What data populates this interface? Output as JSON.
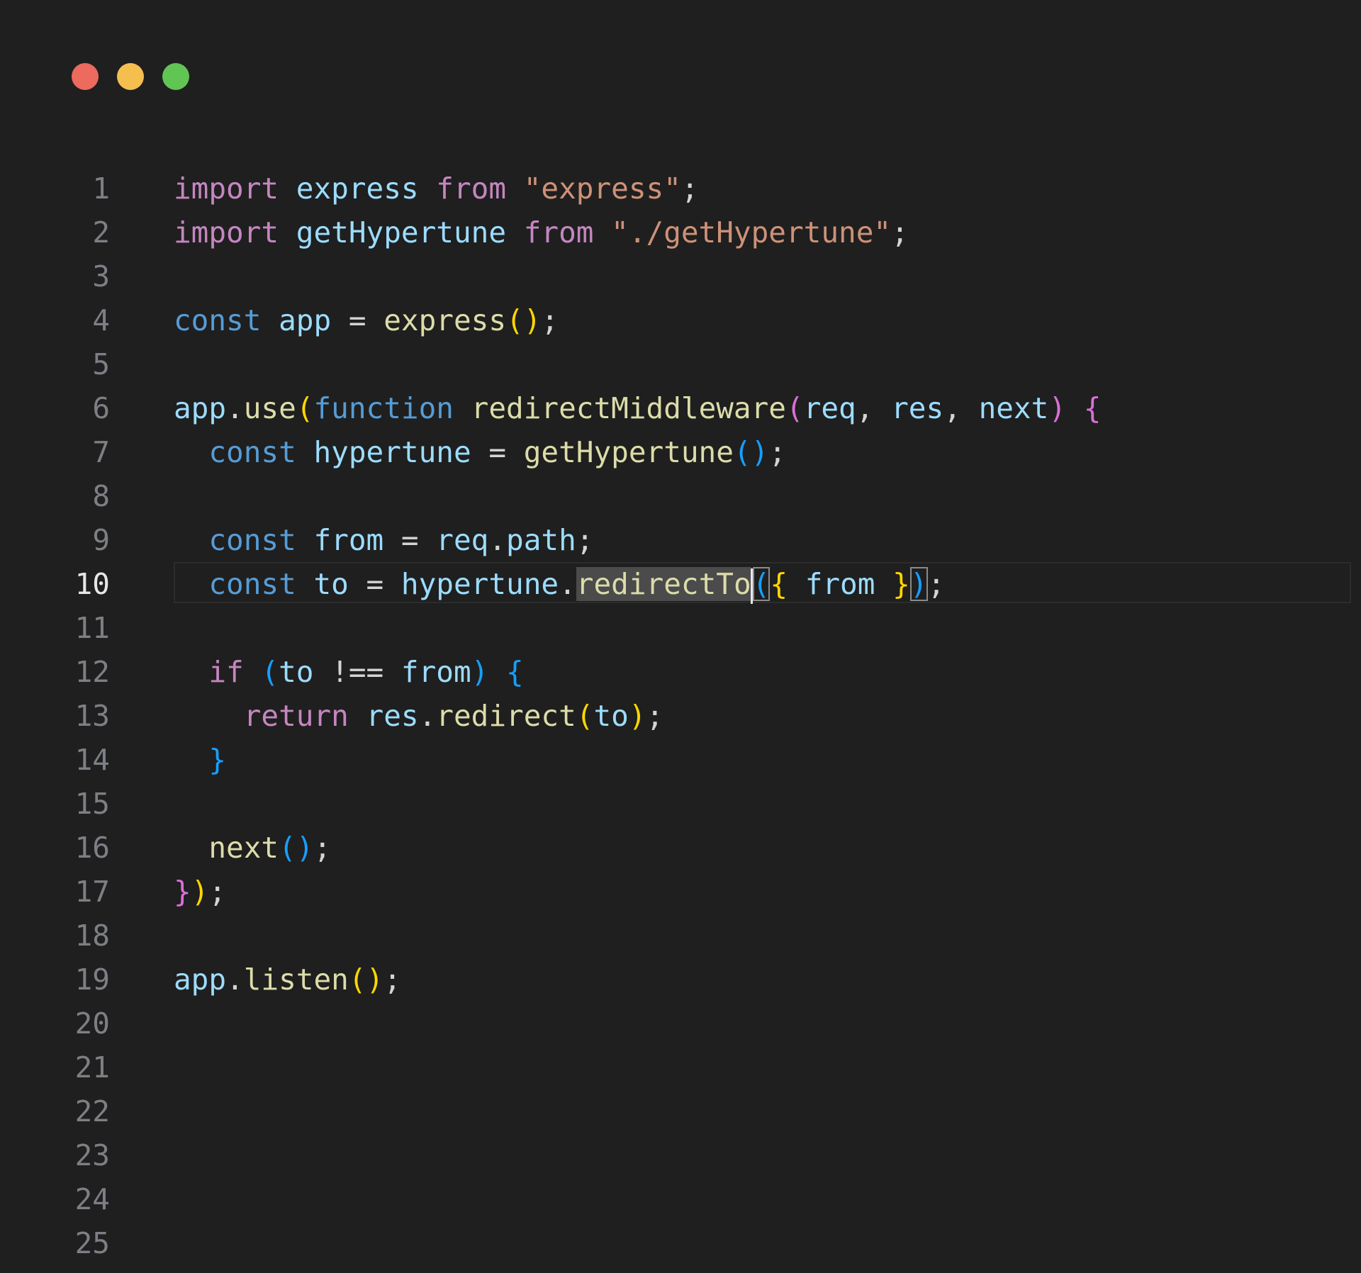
{
  "window": {
    "controls": [
      {
        "name": "close",
        "color": "#ed6a5e"
      },
      {
        "name": "minimize",
        "color": "#f5bf4f"
      },
      {
        "name": "zoom",
        "color": "#61c554"
      }
    ]
  },
  "colors": {
    "keyword_purple": "#c586c0",
    "keyword_blue": "#569cd6",
    "string": "#ce9178",
    "variable": "#9cdcfe",
    "function": "#dcdcaa",
    "bracket_yellow": "#ffd700",
    "bracket_purple": "#da70d6",
    "bracket_blue": "#179fff",
    "default": "#d4d4d4"
  },
  "editor": {
    "active_line": 10,
    "lines": [
      {
        "number": "1",
        "tokens": [
          {
            "t": "import",
            "c": "keyword_purple"
          },
          {
            "t": " "
          },
          {
            "t": "express",
            "c": "variable"
          },
          {
            "t": " "
          },
          {
            "t": "from",
            "c": "keyword_purple"
          },
          {
            "t": " "
          },
          {
            "t": "\"express\"",
            "c": "string"
          },
          {
            "t": ";"
          }
        ]
      },
      {
        "number": "2",
        "tokens": [
          {
            "t": "import",
            "c": "keyword_purple"
          },
          {
            "t": " "
          },
          {
            "t": "getHypertune",
            "c": "variable"
          },
          {
            "t": " "
          },
          {
            "t": "from",
            "c": "keyword_purple"
          },
          {
            "t": " "
          },
          {
            "t": "\"./getHypertune\"",
            "c": "string"
          },
          {
            "t": ";"
          }
        ]
      },
      {
        "number": "3",
        "tokens": []
      },
      {
        "number": "4",
        "tokens": [
          {
            "t": "const",
            "c": "keyword_blue"
          },
          {
            "t": " "
          },
          {
            "t": "app",
            "c": "variable"
          },
          {
            "t": " = "
          },
          {
            "t": "express",
            "c": "function"
          },
          {
            "t": "()",
            "c": "bracket_yellow"
          },
          {
            "t": ";"
          }
        ]
      },
      {
        "number": "5",
        "tokens": []
      },
      {
        "number": "6",
        "tokens": [
          {
            "t": "app",
            "c": "variable"
          },
          {
            "t": "."
          },
          {
            "t": "use",
            "c": "function"
          },
          {
            "t": "(",
            "c": "bracket_yellow"
          },
          {
            "t": "function",
            "c": "keyword_blue"
          },
          {
            "t": " "
          },
          {
            "t": "redirectMiddleware",
            "c": "function"
          },
          {
            "t": "(",
            "c": "bracket_purple"
          },
          {
            "t": "req",
            "c": "variable"
          },
          {
            "t": ", "
          },
          {
            "t": "res",
            "c": "variable"
          },
          {
            "t": ", "
          },
          {
            "t": "next",
            "c": "variable"
          },
          {
            "t": ")",
            "c": "bracket_purple"
          },
          {
            "t": " "
          },
          {
            "t": "{",
            "c": "bracket_purple"
          }
        ]
      },
      {
        "number": "7",
        "tokens": [
          {
            "t": "  "
          },
          {
            "t": "const",
            "c": "keyword_blue"
          },
          {
            "t": " "
          },
          {
            "t": "hypertune",
            "c": "variable"
          },
          {
            "t": " = "
          },
          {
            "t": "getHypertune",
            "c": "function"
          },
          {
            "t": "()",
            "c": "bracket_blue"
          },
          {
            "t": ";"
          }
        ]
      },
      {
        "number": "8",
        "tokens": []
      },
      {
        "number": "9",
        "tokens": [
          {
            "t": "  "
          },
          {
            "t": "const",
            "c": "keyword_blue"
          },
          {
            "t": " "
          },
          {
            "t": "from",
            "c": "variable"
          },
          {
            "t": " = "
          },
          {
            "t": "req",
            "c": "variable"
          },
          {
            "t": "."
          },
          {
            "t": "path",
            "c": "variable"
          },
          {
            "t": ";"
          }
        ]
      },
      {
        "number": "10",
        "tokens": [
          {
            "t": "  "
          },
          {
            "t": "const",
            "c": "keyword_blue"
          },
          {
            "t": " "
          },
          {
            "t": "to",
            "c": "variable"
          },
          {
            "t": " = "
          },
          {
            "t": "hypertune",
            "c": "variable"
          },
          {
            "t": "."
          },
          {
            "t": "redirectTo",
            "c": "function",
            "hl": true
          },
          {
            "t": "(",
            "c": "bracket_blue",
            "match": true,
            "cursor": true
          },
          {
            "t": "{",
            "c": "bracket_yellow"
          },
          {
            "t": " "
          },
          {
            "t": "from",
            "c": "variable"
          },
          {
            "t": " "
          },
          {
            "t": "}",
            "c": "bracket_yellow"
          },
          {
            "t": ")",
            "c": "bracket_blue",
            "match": true
          },
          {
            "t": ";"
          }
        ]
      },
      {
        "number": "11",
        "tokens": []
      },
      {
        "number": "12",
        "tokens": [
          {
            "t": "  "
          },
          {
            "t": "if",
            "c": "keyword_purple"
          },
          {
            "t": " "
          },
          {
            "t": "(",
            "c": "bracket_blue"
          },
          {
            "t": "to",
            "c": "variable"
          },
          {
            "t": " !== "
          },
          {
            "t": "from",
            "c": "variable"
          },
          {
            "t": ")",
            "c": "bracket_blue"
          },
          {
            "t": " "
          },
          {
            "t": "{",
            "c": "bracket_blue"
          }
        ]
      },
      {
        "number": "13",
        "tokens": [
          {
            "t": "    "
          },
          {
            "t": "return",
            "c": "keyword_purple"
          },
          {
            "t": " "
          },
          {
            "t": "res",
            "c": "variable"
          },
          {
            "t": "."
          },
          {
            "t": "redirect",
            "c": "function"
          },
          {
            "t": "(",
            "c": "bracket_yellow"
          },
          {
            "t": "to",
            "c": "variable"
          },
          {
            "t": ")",
            "c": "bracket_yellow"
          },
          {
            "t": ";"
          }
        ]
      },
      {
        "number": "14",
        "tokens": [
          {
            "t": "  "
          },
          {
            "t": "}",
            "c": "bracket_blue"
          }
        ]
      },
      {
        "number": "15",
        "tokens": []
      },
      {
        "number": "16",
        "tokens": [
          {
            "t": "  "
          },
          {
            "t": "next",
            "c": "function"
          },
          {
            "t": "()",
            "c": "bracket_blue"
          },
          {
            "t": ";"
          }
        ]
      },
      {
        "number": "17",
        "tokens": [
          {
            "t": "}",
            "c": "bracket_purple"
          },
          {
            "t": ")",
            "c": "bracket_yellow"
          },
          {
            "t": ";"
          }
        ]
      },
      {
        "number": "18",
        "tokens": []
      },
      {
        "number": "19",
        "tokens": [
          {
            "t": "app",
            "c": "variable"
          },
          {
            "t": "."
          },
          {
            "t": "listen",
            "c": "function"
          },
          {
            "t": "()",
            "c": "bracket_yellow"
          },
          {
            "t": ";"
          }
        ]
      },
      {
        "number": "20",
        "tokens": []
      },
      {
        "number": "21",
        "tokens": []
      },
      {
        "number": "22",
        "tokens": []
      },
      {
        "number": "23",
        "tokens": []
      },
      {
        "number": "24",
        "tokens": []
      },
      {
        "number": "25",
        "tokens": []
      }
    ]
  }
}
